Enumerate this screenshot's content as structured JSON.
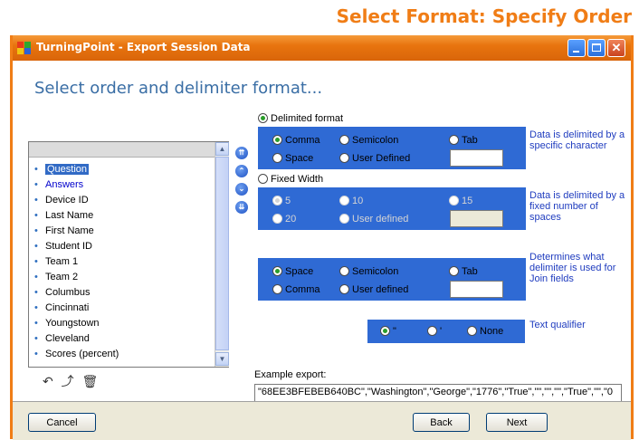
{
  "slide_title": "Select Format: Specify Order",
  "window": {
    "title": "TurningPoint - Export Session Data",
    "heading": "Select order and delimiter format..."
  },
  "field_list": {
    "items": [
      "Question",
      "Answers",
      "Device ID",
      "Last Name",
      "First Name",
      "Student ID",
      "Team 1",
      "Team 2",
      "Columbus",
      "Cincinnati",
      "Youngstown",
      "Cleveland",
      "Scores (percent)"
    ],
    "selected": "Question"
  },
  "order_buttons": [
    "move-to-top-icon",
    "move-up-icon",
    "move-down-icon",
    "move-to-bottom-icon"
  ],
  "delimited": {
    "label": "Delimited format",
    "options": {
      "comma": "Comma",
      "semicolon": "Semicolon",
      "tab": "Tab",
      "space": "Space",
      "user_defined": "User Defined"
    },
    "selected": "Comma",
    "custom_value": "",
    "note": "Data is delimited by a specific character"
  },
  "fixed_width": {
    "label": "Fixed Width",
    "options": {
      "w5": "5",
      "w10": "10",
      "w15": "15",
      "w20": "20",
      "user_defined": "User defined"
    },
    "selected": "5",
    "custom_value": "",
    "note": "Data is delimited by a fixed number of spaces"
  },
  "join": {
    "options": {
      "space": "Space",
      "semicolon": "Semicolon",
      "tab": "Tab",
      "comma": "Comma",
      "user_defined": "User defined"
    },
    "selected": "Space",
    "custom_value": "",
    "note": "Determines what delimiter is used for Join fields"
  },
  "qualifier": {
    "options": {
      "double": "\"",
      "single": "'",
      "none": "None"
    },
    "selected": "\"",
    "note": "Text qualifier"
  },
  "example": {
    "label": "Example export:",
    "text": "\"68EE3BFEBEB640BC\",\"Washington\",\"George\",\"1776\",\"True\",\"\",\"\",\"\",\"True\",\"\",\"0"
  },
  "buttons": {
    "cancel": "Cancel",
    "back": "Back",
    "next": "Next"
  },
  "colors": {
    "accent": "#f07d16",
    "panel": "#2f6ad4",
    "heading": "#3a6ea5",
    "note": "#1f3cbf"
  }
}
